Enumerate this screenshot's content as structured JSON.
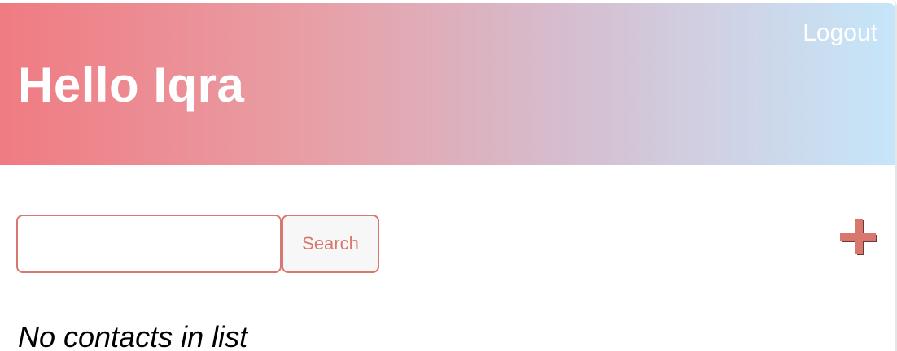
{
  "header": {
    "greeting": "Hello Iqra",
    "logout_label": "Logout"
  },
  "search": {
    "value": "",
    "placeholder": "",
    "button_label": "Search"
  },
  "add_contact": {
    "icon": "plus-icon",
    "color": "#d8776d"
  },
  "contacts": {
    "empty_message": "No contacts in list"
  }
}
